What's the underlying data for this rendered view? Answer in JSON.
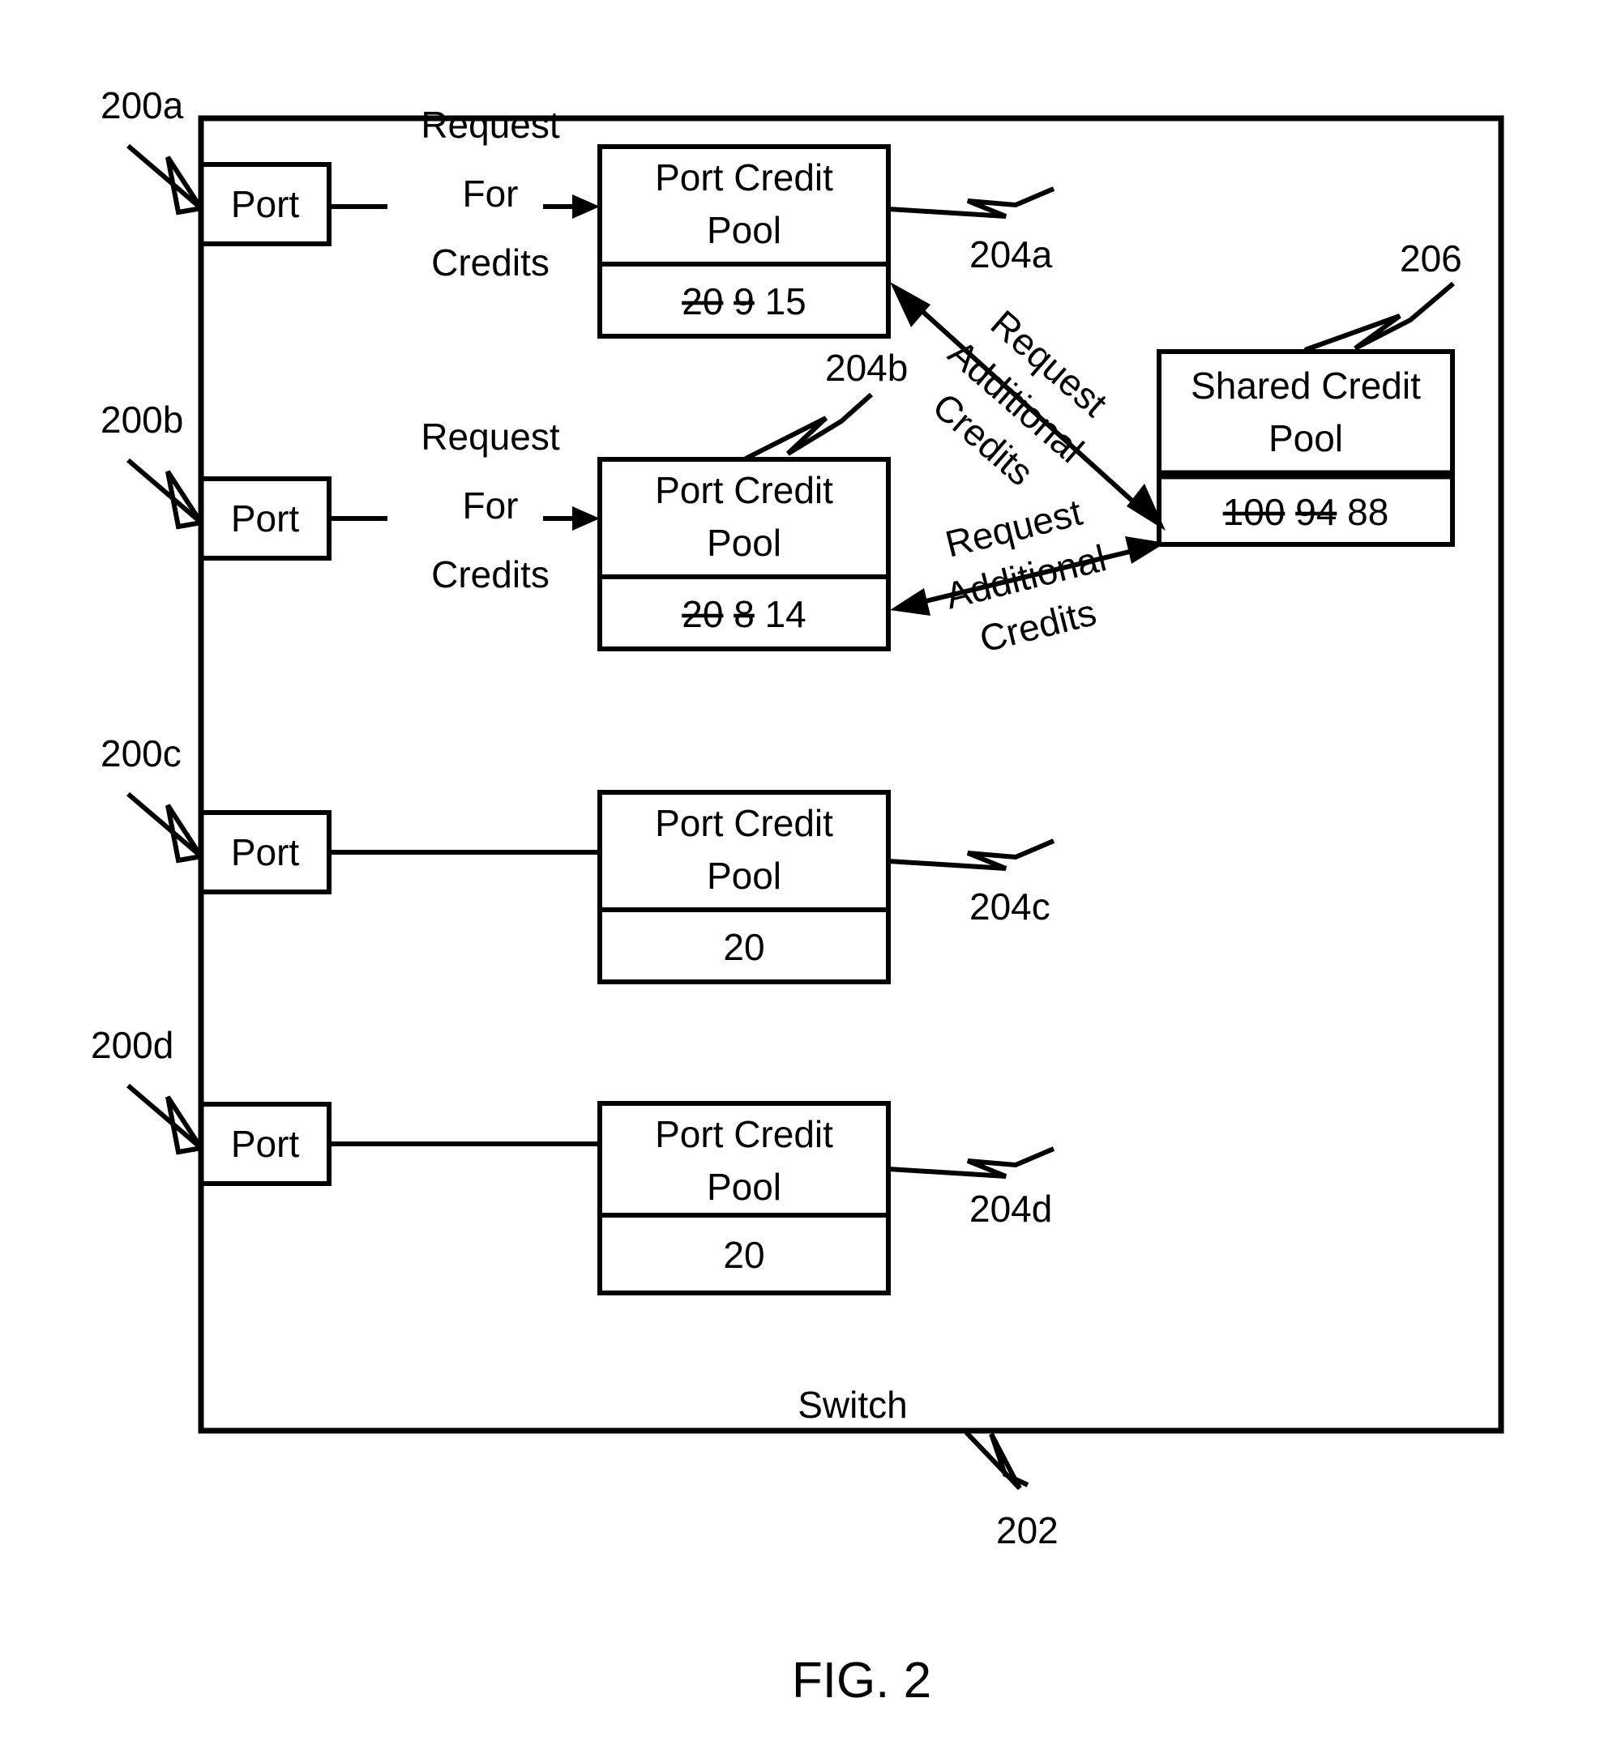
{
  "figure": {
    "caption": "FIG. 2",
    "container_label": "Switch",
    "container_ref": "202"
  },
  "ports": [
    {
      "ref": "200a",
      "label": "Port"
    },
    {
      "ref": "200b",
      "label": "Port"
    },
    {
      "ref": "200c",
      "label": "Port"
    },
    {
      "ref": "200d",
      "label": "Port"
    }
  ],
  "port_credit_pools": [
    {
      "ref": "204a",
      "title_line1": "Port Credit",
      "title_line2": "Pool",
      "values": [
        {
          "text": "20",
          "struck": true
        },
        {
          "text": "9",
          "struck": true
        },
        {
          "text": "15",
          "struck": false
        }
      ]
    },
    {
      "ref": "204b",
      "title_line1": "Port Credit",
      "title_line2": "Pool",
      "values": [
        {
          "text": "20",
          "struck": true
        },
        {
          "text": "8",
          "struck": true
        },
        {
          "text": "14",
          "struck": false
        }
      ]
    },
    {
      "ref": "204c",
      "title_line1": "Port Credit",
      "title_line2": "Pool",
      "values": [
        {
          "text": "20",
          "struck": false
        }
      ]
    },
    {
      "ref": "204d",
      "title_line1": "Port Credit",
      "title_line2": "Pool",
      "values": [
        {
          "text": "20",
          "struck": false
        }
      ]
    }
  ],
  "shared_credit_pool": {
    "ref": "206",
    "title_line1": "Shared Credit",
    "title_line2": "Pool",
    "values": [
      {
        "text": "100",
        "struck": true
      },
      {
        "text": "94",
        "struck": true
      },
      {
        "text": "88",
        "struck": false
      }
    ]
  },
  "flows": {
    "request_for_credits": {
      "line1": "Request",
      "line2": "For",
      "line3": "Credits"
    },
    "request_additional_credits": {
      "line1": "Request",
      "line2": "Additional",
      "line3": "Credits"
    }
  },
  "colors": {
    "stroke": "#000000",
    "background": "#ffffff"
  }
}
